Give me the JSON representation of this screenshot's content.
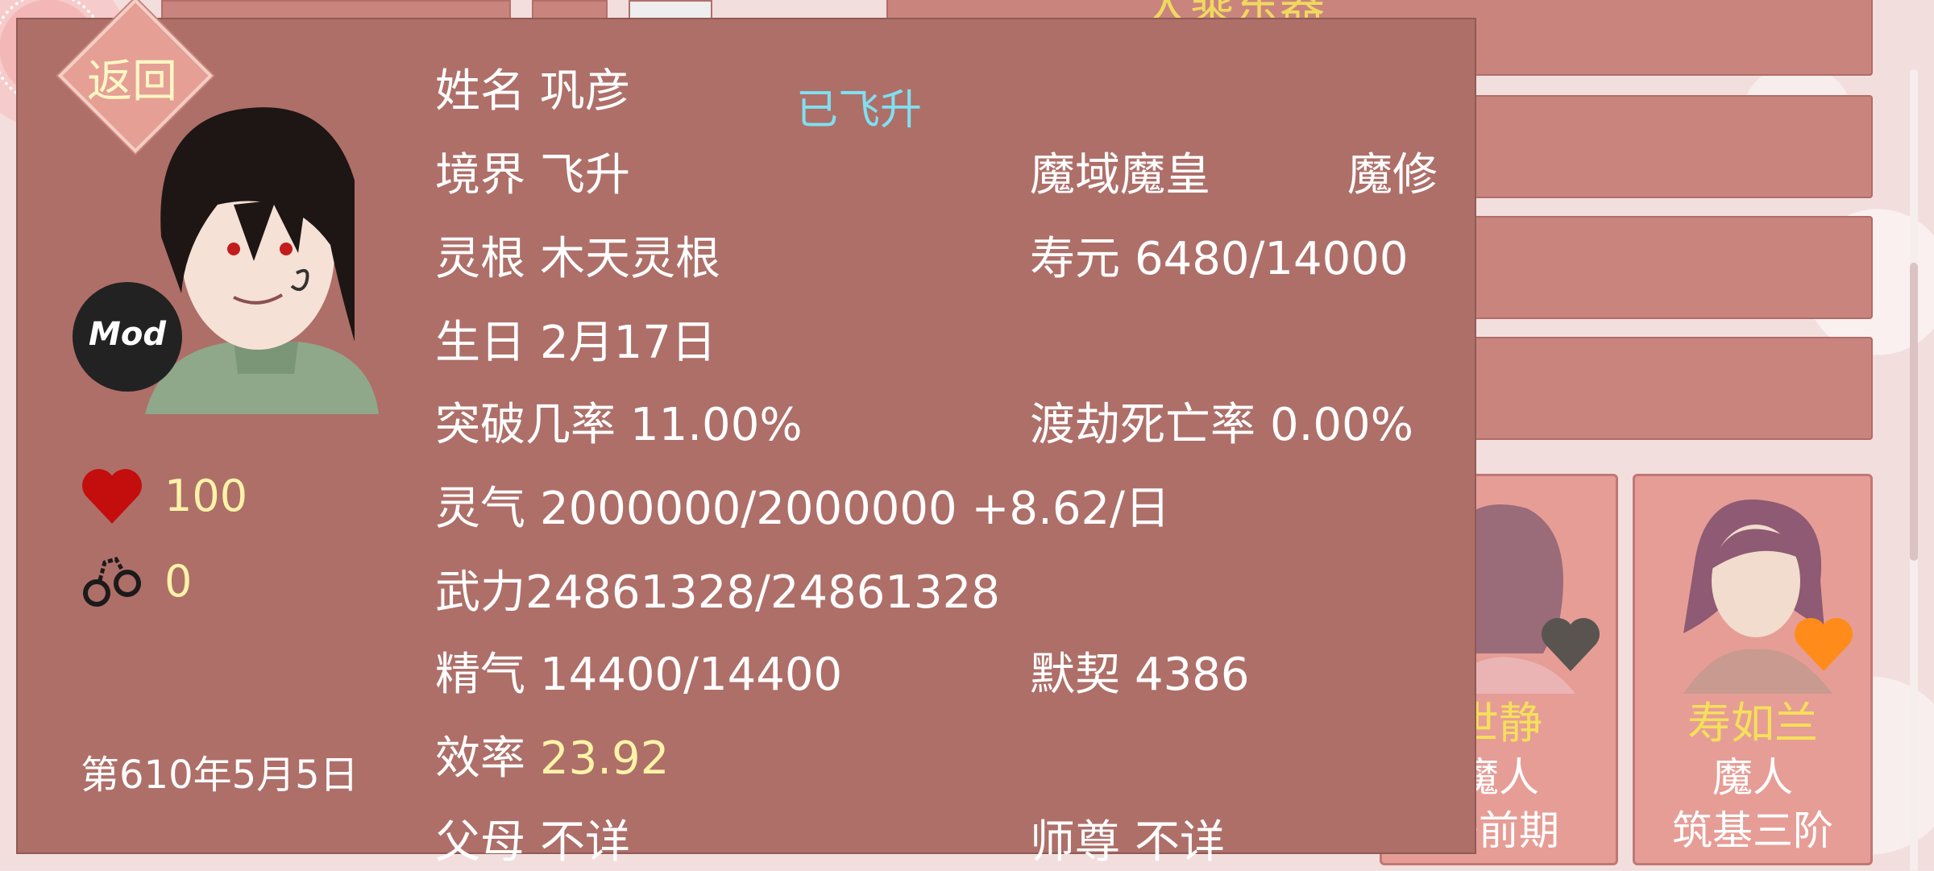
{
  "background": {
    "header_text": "大乘东器",
    "characters": [
      {
        "name": "世静",
        "race": "魔人",
        "realm": "丹前期",
        "heart_color": "#5a5450"
      },
      {
        "name": "寿如兰",
        "race": "魔人",
        "realm": "筑基三阶",
        "heart_color": "#ff8c1a"
      }
    ]
  },
  "panel": {
    "back_label": "返回",
    "mod_label": "Mod",
    "health_value": "100",
    "shackle_value": "0",
    "date": "第610年5月5日",
    "status_tag": "已飞升",
    "name": {
      "label": "姓名",
      "value": "巩彦"
    },
    "realm": {
      "label": "境界",
      "value": "飞升"
    },
    "title": "魔域魔皇",
    "path": "魔修",
    "root": {
      "label": "灵根",
      "value": "木天灵根"
    },
    "lifespan": {
      "label": "寿元",
      "value": "6480/14000"
    },
    "birthday": {
      "label": "生日",
      "value": "2月17日"
    },
    "breakthrough": {
      "label": "突破几率",
      "value": "11.00%"
    },
    "tribulation": {
      "label": "渡劫死亡率",
      "value": "0.00%"
    },
    "qi": {
      "label": "灵气",
      "value": "2000000/2000000 +8.62/日"
    },
    "force": {
      "label": "武力",
      "value": "24861328/24861328"
    },
    "essence": {
      "label": "精气",
      "value": "14400/14400"
    },
    "tacit": {
      "label": "默契",
      "value": "4386"
    },
    "efficiency": {
      "label": "效率",
      "value": "23.92"
    },
    "parents": {
      "label": "父母",
      "value": "不详"
    },
    "master": {
      "label": "师尊",
      "value": "不详"
    }
  }
}
